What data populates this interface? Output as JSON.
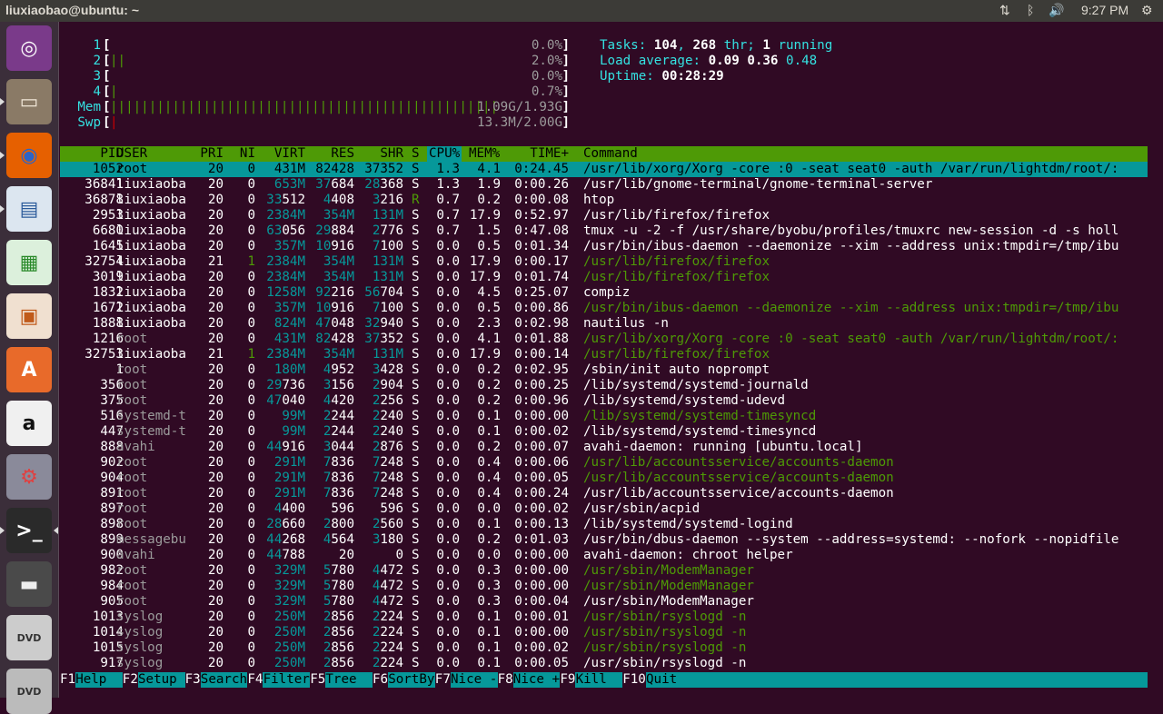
{
  "window": {
    "title": "liuxiaobao@ubuntu: ~"
  },
  "topbar": {
    "time": "9:27 PM",
    "net_icon": "⇅",
    "bt_icon": "ᛒ",
    "vol_icon": "🔊",
    "gear_icon": "⚙"
  },
  "launcher": [
    {
      "name": "ubuntu-dash-icon",
      "glyph": "◎",
      "bg": "#7a3a8a",
      "fg": "#ffffff"
    },
    {
      "name": "files-icon",
      "glyph": "▭",
      "bg": "#8a7a66",
      "fg": "#f0e6d6"
    },
    {
      "name": "firefox-icon",
      "glyph": "◉",
      "bg": "#e66000",
      "fg": "#2a64c8"
    },
    {
      "name": "libreoffice-writer-icon",
      "glyph": "▤",
      "bg": "#dce6f0",
      "fg": "#2a5a9a"
    },
    {
      "name": "libreoffice-calc-icon",
      "glyph": "▦",
      "bg": "#dcf0dc",
      "fg": "#2a8a2a"
    },
    {
      "name": "libreoffice-impress-icon",
      "glyph": "▣",
      "bg": "#f0e0d0",
      "fg": "#c05a1a"
    },
    {
      "name": "software-center-icon",
      "glyph": "A",
      "bg": "#e86a2a",
      "fg": "#ffffff"
    },
    {
      "name": "amazon-icon",
      "glyph": "a",
      "bg": "#f0f0f0",
      "fg": "#111111"
    },
    {
      "name": "system-settings-icon",
      "glyph": "⚙",
      "bg": "#8a8a9a",
      "fg": "#e04040"
    },
    {
      "name": "terminal-icon",
      "glyph": ">_",
      "bg": "#2a2a2a",
      "fg": "#ffffff"
    },
    {
      "name": "floppy-icon",
      "glyph": "▬",
      "bg": "#4a4a4a",
      "fg": "#eeeeee"
    },
    {
      "name": "dvd-icon",
      "glyph": "DVD",
      "bg": "#cccccc",
      "fg": "#333333"
    },
    {
      "name": "dvd-icon-2",
      "glyph": "DVD",
      "bg": "#bbbbbb",
      "fg": "#333333"
    }
  ],
  "meters": [
    {
      "label": "1",
      "bars": "",
      "bar_color": "#4e9a06",
      "value": "0.0%"
    },
    {
      "label": "2",
      "bars": "||",
      "bar_color": "#4e9a06",
      "value": "2.0%"
    },
    {
      "label": "3",
      "bars": "",
      "bar_color": "#4e9a06",
      "value": "0.0%"
    },
    {
      "label": "4",
      "bars": "|",
      "bar_color": "#4e9a06",
      "value": "0.7%"
    },
    {
      "label": "Mem",
      "bars": "||||||||||||||||||||||||||||||||||||||||||||||||||",
      "bar_color": "#4e9a06",
      "value": "1.09G/1.93G"
    },
    {
      "label": "Swp",
      "bars": "|",
      "bar_color": "#cc0000",
      "value": "13.3M/2.00G"
    }
  ],
  "info": {
    "tasks_label": "Tasks: ",
    "tasks": "104",
    "sep1": ", ",
    "thr": "268",
    "thr_label": " thr; ",
    "running": "1",
    "running_label": " running",
    "load_label": "Load average: ",
    "load1": "0.09",
    "load5": "0.36",
    "load15": "0.48",
    "uptime_label": "Uptime: ",
    "uptime": "00:28:29"
  },
  "columns": {
    "pid": "PID",
    "user": "USER",
    "pri": "PRI",
    "ni": "NI",
    "virt": "VIRT",
    "res": "RES",
    "shr": "SHR",
    "s": "S",
    "cpu": "CPU%",
    "mem": "MEM%",
    "time": "TIME+",
    "cmd": "Command"
  },
  "processes": [
    {
      "pid": "1052",
      "user": "root",
      "pri": "20",
      "ni": "0",
      "virt": "431M",
      "res": "82428",
      "shr": "37352",
      "s": "S",
      "cpu": "1.3",
      "mem": "4.1",
      "time": "0:24.45",
      "cmd": "/usr/lib/xorg/Xorg -core :0 -seat seat0 -auth /var/run/lightdm/root/:",
      "thread": false
    },
    {
      "pid": "36841",
      "user": "liuxiaoba",
      "pri": "20",
      "ni": "0",
      "virt": "653M",
      "res": "37684",
      "shr": "28368",
      "s": "S",
      "cpu": "1.3",
      "mem": "1.9",
      "time": "0:00.26",
      "cmd": "/usr/lib/gnome-terminal/gnome-terminal-server",
      "thread": false
    },
    {
      "pid": "36878",
      "user": "liuxiaoba",
      "pri": "20",
      "ni": "0",
      "virt": "33512",
      "res": "4408",
      "shr": "3216",
      "s": "R",
      "cpu": "0.7",
      "mem": "0.2",
      "time": "0:00.08",
      "cmd": "htop",
      "thread": false
    },
    {
      "pid": "2953",
      "user": "liuxiaoba",
      "pri": "20",
      "ni": "0",
      "virt": "2384M",
      "res": "354M",
      "shr": "131M",
      "s": "S",
      "cpu": "0.7",
      "mem": "17.9",
      "time": "0:52.97",
      "cmd": "/usr/lib/firefox/firefox",
      "thread": false
    },
    {
      "pid": "6680",
      "user": "liuxiaoba",
      "pri": "20",
      "ni": "0",
      "virt": "63056",
      "res": "29884",
      "shr": "2776",
      "s": "S",
      "cpu": "0.7",
      "mem": "1.5",
      "time": "0:47.08",
      "cmd": "tmux -u -2 -f /usr/share/byobu/profiles/tmuxrc new-session -d -s holl",
      "thread": false
    },
    {
      "pid": "1645",
      "user": "liuxiaoba",
      "pri": "20",
      "ni": "0",
      "virt": "357M",
      "res": "10916",
      "shr": "7100",
      "s": "S",
      "cpu": "0.0",
      "mem": "0.5",
      "time": "0:01.34",
      "cmd": "/usr/bin/ibus-daemon --daemonize --xim --address unix:tmpdir=/tmp/ibu",
      "thread": false
    },
    {
      "pid": "32754",
      "user": "liuxiaoba",
      "pri": "21",
      "ni": "1",
      "virt": "2384M",
      "res": "354M",
      "shr": "131M",
      "s": "S",
      "cpu": "0.0",
      "mem": "17.9",
      "time": "0:00.17",
      "cmd": "/usr/lib/firefox/firefox",
      "thread": true
    },
    {
      "pid": "3019",
      "user": "liuxiaoba",
      "pri": "20",
      "ni": "0",
      "virt": "2384M",
      "res": "354M",
      "shr": "131M",
      "s": "S",
      "cpu": "0.0",
      "mem": "17.9",
      "time": "0:01.74",
      "cmd": "/usr/lib/firefox/firefox",
      "thread": true
    },
    {
      "pid": "1832",
      "user": "liuxiaoba",
      "pri": "20",
      "ni": "0",
      "virt": "1258M",
      "res": "92216",
      "shr": "56704",
      "s": "S",
      "cpu": "0.0",
      "mem": "4.5",
      "time": "0:25.07",
      "cmd": "compiz",
      "thread": false
    },
    {
      "pid": "1672",
      "user": "liuxiaoba",
      "pri": "20",
      "ni": "0",
      "virt": "357M",
      "res": "10916",
      "shr": "7100",
      "s": "S",
      "cpu": "0.0",
      "mem": "0.5",
      "time": "0:00.86",
      "cmd": "/usr/bin/ibus-daemon --daemonize --xim --address unix:tmpdir=/tmp/ibu",
      "thread": true
    },
    {
      "pid": "1888",
      "user": "liuxiaoba",
      "pri": "20",
      "ni": "0",
      "virt": "824M",
      "res": "47048",
      "shr": "32940",
      "s": "S",
      "cpu": "0.0",
      "mem": "2.3",
      "time": "0:02.98",
      "cmd": "nautilus -n",
      "thread": false
    },
    {
      "pid": "1216",
      "user": "root",
      "pri": "20",
      "ni": "0",
      "virt": "431M",
      "res": "82428",
      "shr": "37352",
      "s": "S",
      "cpu": "0.0",
      "mem": "4.1",
      "time": "0:01.88",
      "cmd": "/usr/lib/xorg/Xorg -core :0 -seat seat0 -auth /var/run/lightdm/root/:",
      "thread": true
    },
    {
      "pid": "32753",
      "user": "liuxiaoba",
      "pri": "21",
      "ni": "1",
      "virt": "2384M",
      "res": "354M",
      "shr": "131M",
      "s": "S",
      "cpu": "0.0",
      "mem": "17.9",
      "time": "0:00.14",
      "cmd": "/usr/lib/firefox/firefox",
      "thread": true
    },
    {
      "pid": "1",
      "user": "root",
      "pri": "20",
      "ni": "0",
      "virt": "180M",
      "res": "4952",
      "shr": "3428",
      "s": "S",
      "cpu": "0.0",
      "mem": "0.2",
      "time": "0:02.95",
      "cmd": "/sbin/init auto noprompt",
      "thread": false
    },
    {
      "pid": "356",
      "user": "root",
      "pri": "20",
      "ni": "0",
      "virt": "29736",
      "res": "3156",
      "shr": "2904",
      "s": "S",
      "cpu": "0.0",
      "mem": "0.2",
      "time": "0:00.25",
      "cmd": "/lib/systemd/systemd-journald",
      "thread": false
    },
    {
      "pid": "375",
      "user": "root",
      "pri": "20",
      "ni": "0",
      "virt": "47040",
      "res": "4420",
      "shr": "2256",
      "s": "S",
      "cpu": "0.0",
      "mem": "0.2",
      "time": "0:00.96",
      "cmd": "/lib/systemd/systemd-udevd",
      "thread": false
    },
    {
      "pid": "516",
      "user": "systemd-t",
      "pri": "20",
      "ni": "0",
      "virt": "99M",
      "res": "2244",
      "shr": "2240",
      "s": "S",
      "cpu": "0.0",
      "mem": "0.1",
      "time": "0:00.00",
      "cmd": "/lib/systemd/systemd-timesyncd",
      "thread": true
    },
    {
      "pid": "447",
      "user": "systemd-t",
      "pri": "20",
      "ni": "0",
      "virt": "99M",
      "res": "2244",
      "shr": "2240",
      "s": "S",
      "cpu": "0.0",
      "mem": "0.1",
      "time": "0:00.02",
      "cmd": "/lib/systemd/systemd-timesyncd",
      "thread": false
    },
    {
      "pid": "888",
      "user": "avahi",
      "pri": "20",
      "ni": "0",
      "virt": "44916",
      "res": "3044",
      "shr": "2876",
      "s": "S",
      "cpu": "0.0",
      "mem": "0.2",
      "time": "0:00.07",
      "cmd": "avahi-daemon: running [ubuntu.local]",
      "thread": false
    },
    {
      "pid": "902",
      "user": "root",
      "pri": "20",
      "ni": "0",
      "virt": "291M",
      "res": "7836",
      "shr": "7248",
      "s": "S",
      "cpu": "0.0",
      "mem": "0.4",
      "time": "0:00.06",
      "cmd": "/usr/lib/accountsservice/accounts-daemon",
      "thread": true
    },
    {
      "pid": "904",
      "user": "root",
      "pri": "20",
      "ni": "0",
      "virt": "291M",
      "res": "7836",
      "shr": "7248",
      "s": "S",
      "cpu": "0.0",
      "mem": "0.4",
      "time": "0:00.05",
      "cmd": "/usr/lib/accountsservice/accounts-daemon",
      "thread": true
    },
    {
      "pid": "891",
      "user": "root",
      "pri": "20",
      "ni": "0",
      "virt": "291M",
      "res": "7836",
      "shr": "7248",
      "s": "S",
      "cpu": "0.0",
      "mem": "0.4",
      "time": "0:00.24",
      "cmd": "/usr/lib/accountsservice/accounts-daemon",
      "thread": false
    },
    {
      "pid": "897",
      "user": "root",
      "pri": "20",
      "ni": "0",
      "virt": "4400",
      "res": "596",
      "shr": "596",
      "s": "S",
      "cpu": "0.0",
      "mem": "0.0",
      "time": "0:00.02",
      "cmd": "/usr/sbin/acpid",
      "thread": false
    },
    {
      "pid": "898",
      "user": "root",
      "pri": "20",
      "ni": "0",
      "virt": "28660",
      "res": "2800",
      "shr": "2560",
      "s": "S",
      "cpu": "0.0",
      "mem": "0.1",
      "time": "0:00.13",
      "cmd": "/lib/systemd/systemd-logind",
      "thread": false
    },
    {
      "pid": "899",
      "user": "messagebu",
      "pri": "20",
      "ni": "0",
      "virt": "44268",
      "res": "4564",
      "shr": "3180",
      "s": "S",
      "cpu": "0.0",
      "mem": "0.2",
      "time": "0:01.03",
      "cmd": "/usr/bin/dbus-daemon --system --address=systemd: --nofork --nopidfile",
      "thread": false
    },
    {
      "pid": "900",
      "user": "avahi",
      "pri": "20",
      "ni": "0",
      "virt": "44788",
      "res": "20",
      "shr": "0",
      "s": "S",
      "cpu": "0.0",
      "mem": "0.0",
      "time": "0:00.00",
      "cmd": "avahi-daemon: chroot helper",
      "thread": false
    },
    {
      "pid": "982",
      "user": "root",
      "pri": "20",
      "ni": "0",
      "virt": "329M",
      "res": "5780",
      "shr": "4472",
      "s": "S",
      "cpu": "0.0",
      "mem": "0.3",
      "time": "0:00.00",
      "cmd": "/usr/sbin/ModemManager",
      "thread": true
    },
    {
      "pid": "984",
      "user": "root",
      "pri": "20",
      "ni": "0",
      "virt": "329M",
      "res": "5780",
      "shr": "4472",
      "s": "S",
      "cpu": "0.0",
      "mem": "0.3",
      "time": "0:00.00",
      "cmd": "/usr/sbin/ModemManager",
      "thread": true
    },
    {
      "pid": "905",
      "user": "root",
      "pri": "20",
      "ni": "0",
      "virt": "329M",
      "res": "5780",
      "shr": "4472",
      "s": "S",
      "cpu": "0.0",
      "mem": "0.3",
      "time": "0:00.04",
      "cmd": "/usr/sbin/ModemManager",
      "thread": false
    },
    {
      "pid": "1013",
      "user": "syslog",
      "pri": "20",
      "ni": "0",
      "virt": "250M",
      "res": "2856",
      "shr": "2224",
      "s": "S",
      "cpu": "0.0",
      "mem": "0.1",
      "time": "0:00.01",
      "cmd": "/usr/sbin/rsyslogd -n",
      "thread": true
    },
    {
      "pid": "1014",
      "user": "syslog",
      "pri": "20",
      "ni": "0",
      "virt": "250M",
      "res": "2856",
      "shr": "2224",
      "s": "S",
      "cpu": "0.0",
      "mem": "0.1",
      "time": "0:00.00",
      "cmd": "/usr/sbin/rsyslogd -n",
      "thread": true
    },
    {
      "pid": "1015",
      "user": "syslog",
      "pri": "20",
      "ni": "0",
      "virt": "250M",
      "res": "2856",
      "shr": "2224",
      "s": "S",
      "cpu": "0.0",
      "mem": "0.1",
      "time": "0:00.02",
      "cmd": "/usr/sbin/rsyslogd -n",
      "thread": true
    },
    {
      "pid": "917",
      "user": "syslog",
      "pri": "20",
      "ni": "0",
      "virt": "250M",
      "res": "2856",
      "shr": "2224",
      "s": "S",
      "cpu": "0.0",
      "mem": "0.1",
      "time": "0:00.05",
      "cmd": "/usr/sbin/rsyslogd -n",
      "thread": false
    }
  ],
  "fkeys": [
    {
      "key": "F1",
      "label": "Help"
    },
    {
      "key": "F2",
      "label": "Setup"
    },
    {
      "key": "F3",
      "label": "Search"
    },
    {
      "key": "F4",
      "label": "Filter"
    },
    {
      "key": "F5",
      "label": "Tree"
    },
    {
      "key": "F6",
      "label": "SortBy"
    },
    {
      "key": "F7",
      "label": "Nice -"
    },
    {
      "key": "F8",
      "label": "Nice +"
    },
    {
      "key": "F9",
      "label": "Kill"
    },
    {
      "key": "F10",
      "label": "Quit"
    }
  ]
}
